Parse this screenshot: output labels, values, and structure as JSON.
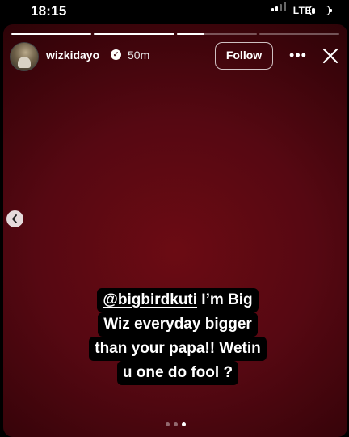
{
  "status_bar": {
    "time": "18:15",
    "network": "LTE",
    "signal_bars": 4,
    "signal_bars_active": 2,
    "battery_level": 0.25
  },
  "story": {
    "progress_segments": [
      1,
      1,
      0.35,
      0
    ],
    "user": {
      "username": "wizkidayo",
      "verified_icon": "check",
      "time_ago": "50m"
    },
    "follow_label": "Follow",
    "more_icon": "•••",
    "caption": {
      "mention": "@bigbirdkuti",
      "line1_rest": " I’m Big",
      "line2": "Wiz everyday bigger",
      "line3": "than your papa!! Wetin",
      "line4": "u one do fool ?"
    },
    "page_dots": 3,
    "active_dot": 3
  },
  "colors": {
    "background_center": "#6b0b13",
    "background_edge": "#2a0307",
    "caption_bg": "#000000"
  }
}
